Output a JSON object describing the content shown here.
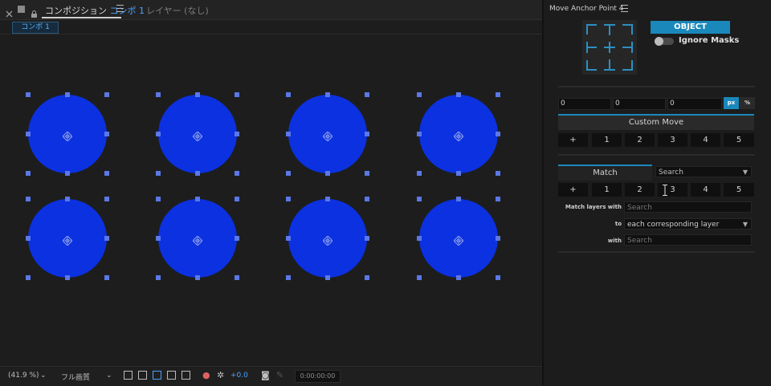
{
  "comp_panel": {
    "tab_label": "コンポジション",
    "tab_comp_name": "コンポ 1",
    "layer_tab": "レイヤー (なし)",
    "sub_tab": "コンポ 1"
  },
  "bottom_bar": {
    "zoom": "(41.9 %)",
    "resolution": "フル画質",
    "exposure": "+0.0",
    "timecode": "0:00:00:00"
  },
  "plugin": {
    "title": "Move Anchor Point 4",
    "object_button": "OBJECT",
    "ignore_masks_label": "Ignore Masks",
    "ignore_masks_on": false,
    "inputs": [
      "0",
      "0",
      "0"
    ],
    "unit_px": "px",
    "unit_percent": "%",
    "custom_move_label": "Custom Move",
    "custom_move_buttons": [
      "+",
      "1",
      "2",
      "3",
      "4",
      "5"
    ],
    "match_tab": "Match",
    "match_select": "Search",
    "match_buttons": [
      "+",
      "1",
      "2",
      "3",
      "4",
      "5"
    ],
    "match_layers_with_label": "Match layers with",
    "match_layers_with_placeholder": "Search",
    "to_label": "to",
    "to_select": "each corresponding layer",
    "with_label": "with",
    "with_placeholder": "Search"
  },
  "colors": {
    "accent": "#1a88bb",
    "circle_fill": "#0b31e0",
    "handle": "#5b78e6",
    "comp_name": "#4aa3ff"
  },
  "icons": [
    "lock-icon",
    "square-icon",
    "menu-icon",
    "grid-icon",
    "transparency-icon",
    "mask-icon",
    "snapshot-icon",
    "camera-icon"
  ]
}
